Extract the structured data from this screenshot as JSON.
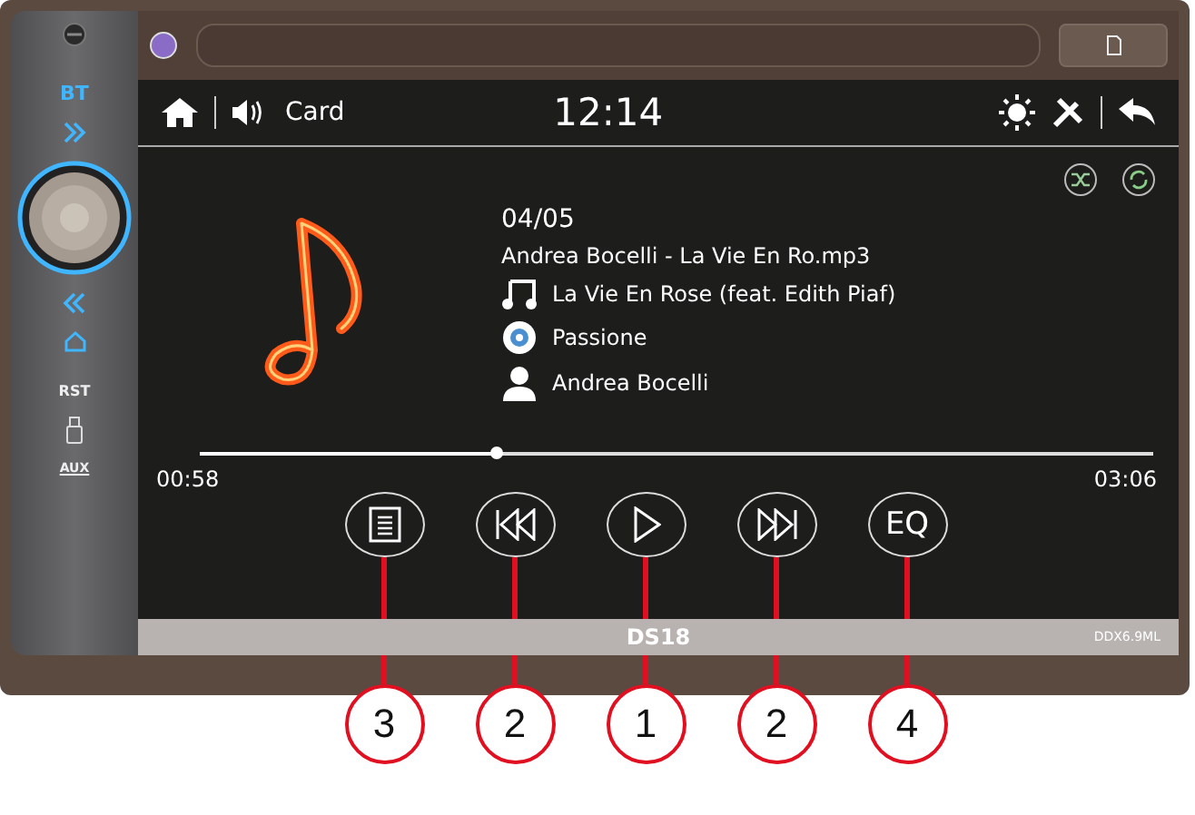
{
  "side_panel": {
    "bt": "BT",
    "rst": "RST",
    "aux": "AUX"
  },
  "top_bar": {
    "source": "Card",
    "time": "12:14"
  },
  "track": {
    "index": "04/05",
    "file": "Andrea Bocelli - La Vie En Ro.mp3",
    "title": "La Vie En Rose (feat. Edith Piaf)",
    "album": "Passione",
    "artist": "Andrea Bocelli"
  },
  "progress": {
    "elapsed": "00:58",
    "total": "03:06",
    "level": 0.31
  },
  "controls": [
    {
      "kind": "list",
      "callout": "3"
    },
    {
      "kind": "prev",
      "callout": "2"
    },
    {
      "kind": "play",
      "callout": "1"
    },
    {
      "kind": "next",
      "callout": "2"
    },
    {
      "kind": "eq",
      "label": "EQ",
      "callout": "4"
    }
  ],
  "bezel": {
    "logo": "DS18",
    "model": "DDX6.9ML"
  }
}
